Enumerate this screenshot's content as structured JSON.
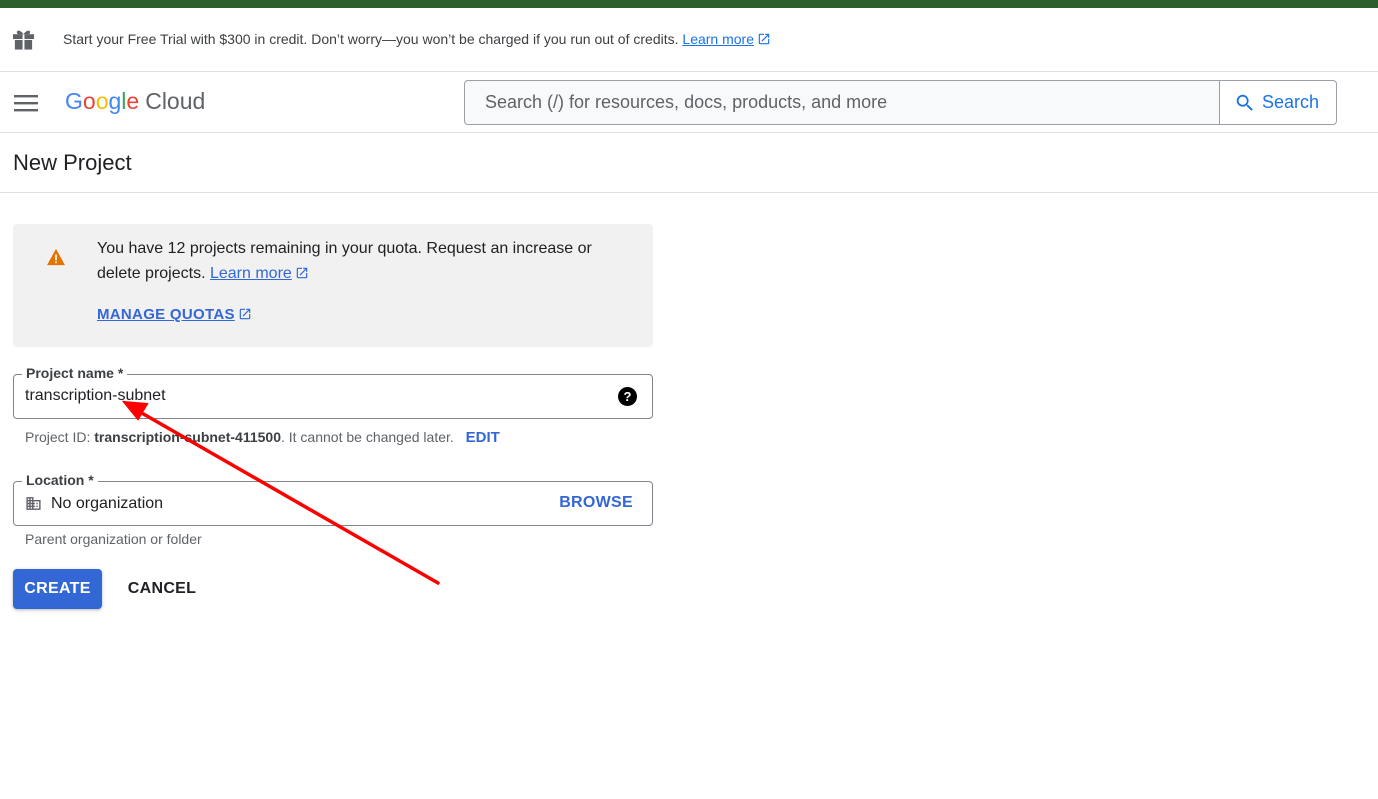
{
  "banner": {
    "text": "Start your Free Trial with $300 in credit. Don’t worry—you won’t be charged if you run out of credits.",
    "link_text": "Learn more",
    "icon": "gift-icon"
  },
  "header": {
    "logo_google": "Google",
    "logo_cloud": "Cloud",
    "search_placeholder": "Search (/) for resources, docs, products, and more",
    "search_button": "Search"
  },
  "page": {
    "title": "New Project"
  },
  "quota": {
    "text": "You have 12 projects remaining in your quota. Request an increase or delete projects.",
    "learn_more": "Learn more",
    "manage_quotas": "MANAGE QUOTAS"
  },
  "project_name": {
    "label": "Project name *",
    "value": "transcription-subnet"
  },
  "project_id": {
    "prefix": "Project ID:",
    "id": "transcription-subnet-411500",
    "suffix": ". It cannot be changed later.",
    "edit": "EDIT"
  },
  "location": {
    "label": "Location *",
    "value": "No organization",
    "browse": "BROWSE",
    "help": "Parent organization or folder"
  },
  "actions": {
    "create": "CREATE",
    "cancel": "CANCEL"
  },
  "colors": {
    "accent": "#3367d6",
    "link": "#1a73e8",
    "warning": "#e37400",
    "top_stripe": "#2d5e2e",
    "annotation": "#ff0000"
  }
}
